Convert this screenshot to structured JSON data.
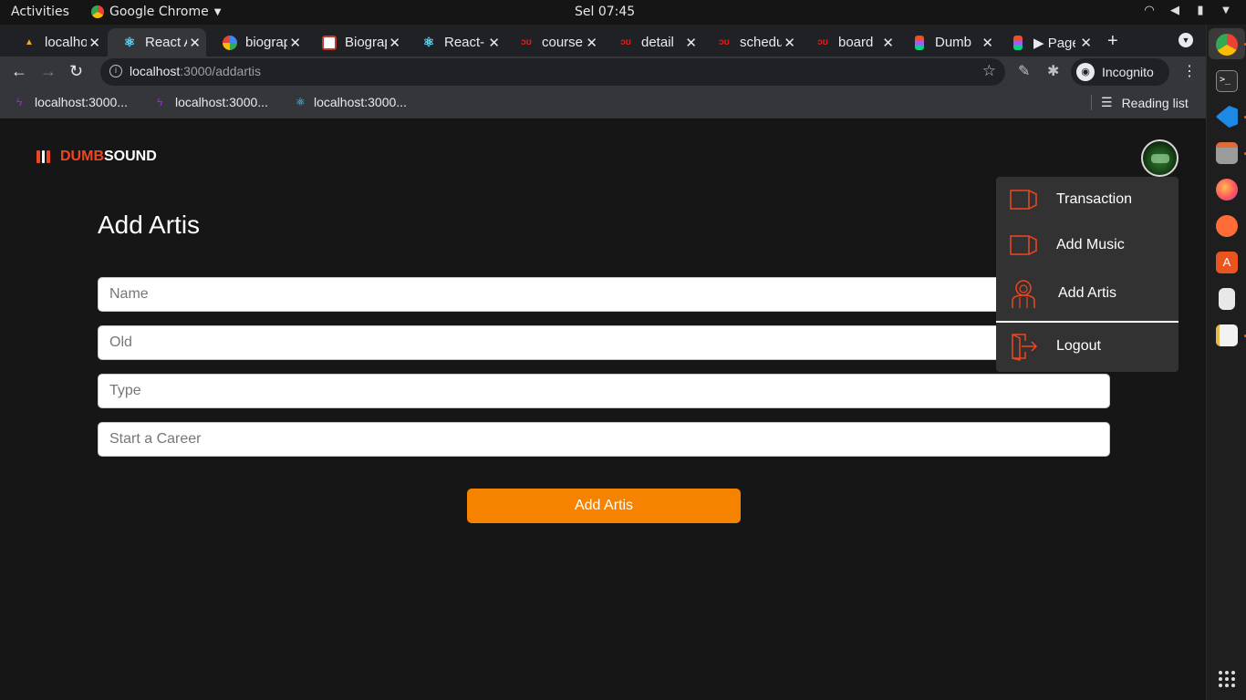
{
  "os": {
    "activities": "Activities",
    "app_name": "Google Chrome",
    "clock": "Sel 07:45"
  },
  "browser": {
    "tabs": [
      {
        "title": "localhost",
        "icon": "vite-icon"
      },
      {
        "title": "React App",
        "icon": "react-icon"
      },
      {
        "title": "biography",
        "icon": "google-icon"
      },
      {
        "title": "Biography",
        "icon": "site-icon"
      },
      {
        "title": "React-",
        "icon": "react-icon"
      },
      {
        "title": "course",
        "icon": "dw-icon"
      },
      {
        "title": "detail",
        "icon": "dw-icon"
      },
      {
        "title": "schedule",
        "icon": "dw-icon"
      },
      {
        "title": "board",
        "icon": "dw-icon"
      },
      {
        "title": "Dumb",
        "icon": "figma-icon"
      },
      {
        "title": "▶ Page",
        "icon": "figma-icon"
      }
    ],
    "url_host": "localhost",
    "url_path": ":3000/addartis",
    "profile_label": "Incognito",
    "bookmarks": [
      "localhost:3000...",
      "localhost:3000...",
      "localhost:3000..."
    ],
    "reading_list": "Reading list"
  },
  "app": {
    "logo_dumb": "DUMB",
    "logo_sound": "SOUND",
    "page_title": "Add Artis",
    "fields": {
      "name_placeholder": "Name",
      "old_placeholder": "Old",
      "type_placeholder": "Type",
      "career_placeholder": "Start a Career"
    },
    "submit_label": "Add Artis",
    "menu": {
      "transaction": "Transaction",
      "add_music": "Add Music",
      "add_artis": "Add Artis",
      "logout": "Logout"
    }
  },
  "colors": {
    "accent": "#f58300",
    "brand_red": "#ee4622",
    "background": "#161616",
    "dropdown_bg": "#323232"
  }
}
